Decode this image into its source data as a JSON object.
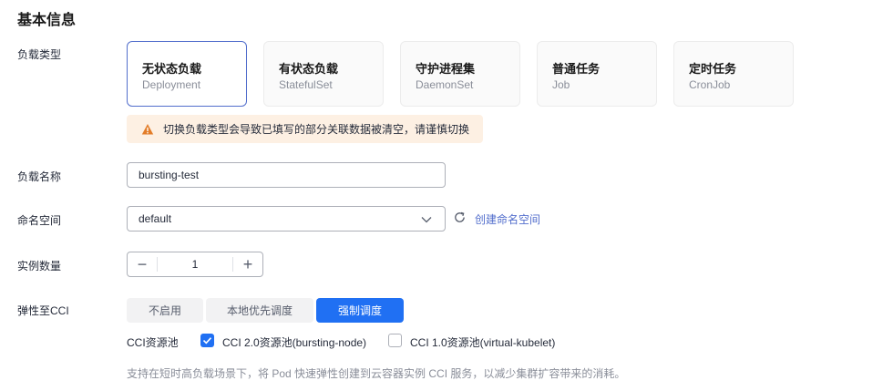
{
  "section_title": "基本信息",
  "labels": {
    "workload_type": "负载类型",
    "workload_name": "负载名称",
    "namespace": "命名空间",
    "instances": "实例数量",
    "burst_cci": "弹性至CCI",
    "cci_pool": "CCI资源池"
  },
  "workload_types": [
    {
      "title": "无状态负载",
      "subtitle": "Deployment",
      "selected": true
    },
    {
      "title": "有状态负载",
      "subtitle": "StatefulSet",
      "selected": false
    },
    {
      "title": "守护进程集",
      "subtitle": "DaemonSet",
      "selected": false
    },
    {
      "title": "普通任务",
      "subtitle": "Job",
      "selected": false
    },
    {
      "title": "定时任务",
      "subtitle": "CronJob",
      "selected": false
    }
  ],
  "warning": {
    "icon": "warning-icon",
    "text": "切换负载类型会导致已填写的部分关联数据被清空，请谨慎切换"
  },
  "name_input": {
    "value": "bursting-test"
  },
  "namespace_select": {
    "value": "default",
    "refresh_icon": "refresh-icon",
    "create_link": "创建命名空间"
  },
  "stepper": {
    "value": "1",
    "minus": "−",
    "plus": "+"
  },
  "burst_options": [
    {
      "label": "不启用",
      "selected": false
    },
    {
      "label": "本地优先调度",
      "selected": false
    },
    {
      "label": "强制调度",
      "selected": true
    }
  ],
  "pools": [
    {
      "label": "CCI 2.0资源池(bursting-node)",
      "checked": true
    },
    {
      "label": "CCI 1.0资源池(virtual-kubelet)",
      "checked": false
    }
  ],
  "hint": "支持在短时高负载场景下，将 Pod 快速弹性创建到云容器实例 CCI 服务，以减少集群扩容带来的消耗。",
  "colors": {
    "accent": "#2070f3",
    "warning_bg": "#fdf0e3",
    "warning_icon": "#e37d29",
    "link": "#526ecc"
  }
}
